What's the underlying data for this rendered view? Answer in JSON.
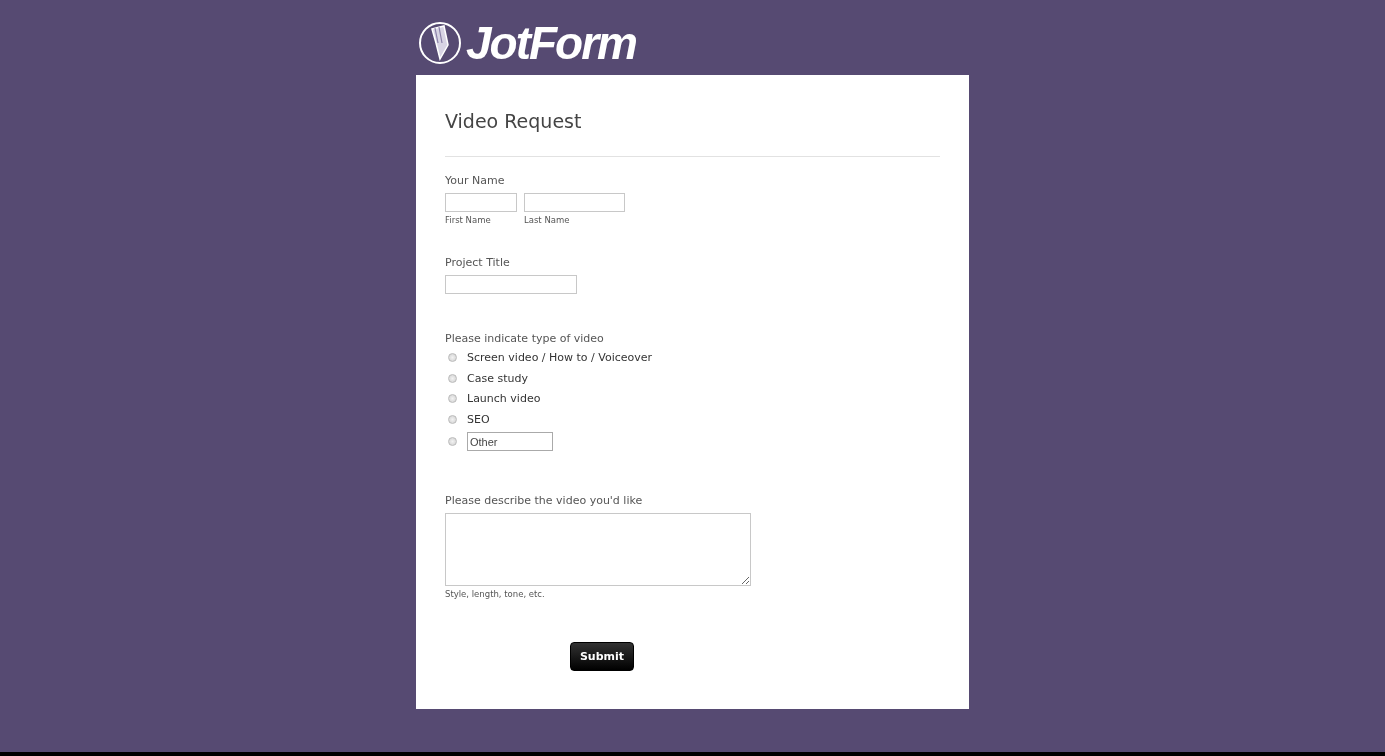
{
  "logo": {
    "text": "JotForm"
  },
  "form": {
    "title": "Video Request",
    "name_field": {
      "label": "Your Name",
      "parts": [
        {
          "sublabel": "First Name"
        },
        {
          "sublabel": "Last Name"
        }
      ]
    },
    "project_title": {
      "label": "Project Title"
    },
    "video_type": {
      "label": "Please indicate type of video",
      "options": [
        {
          "kind": "option",
          "label": "Screen video / How to / Voiceover",
          "selected": false
        },
        {
          "kind": "option",
          "label": "Case study",
          "selected": false
        },
        {
          "kind": "option",
          "label": "Launch video",
          "selected": false
        },
        {
          "kind": "option",
          "label": "SEO",
          "selected": false
        },
        {
          "kind": "other",
          "placeholder": "Other",
          "selected": false
        }
      ]
    },
    "description": {
      "label": "Please describe the video you'd like",
      "sublabel": "Style, length, tone, etc."
    },
    "submit": "Submit"
  }
}
